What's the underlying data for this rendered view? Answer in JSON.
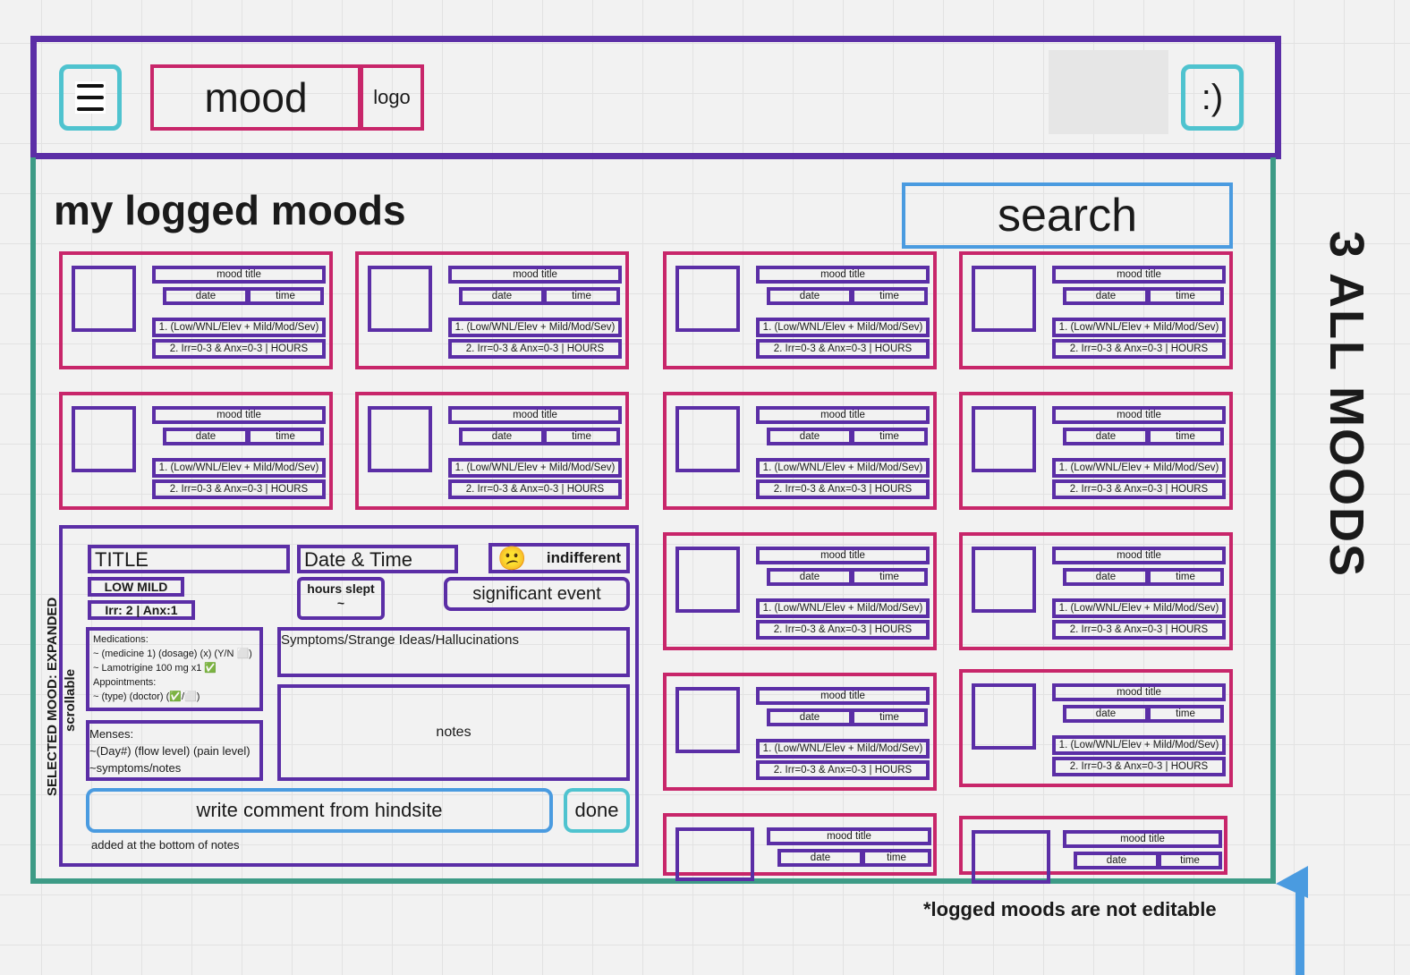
{
  "header": {
    "app_name": "mood",
    "logo_label": "logo",
    "profile_label": ":)",
    "menu_icon": "hamburger-menu-icon"
  },
  "main": {
    "title": "my logged moods",
    "search_label": "search",
    "side_label": "3 ALL MOODS",
    "footnote": "*logged moods are not editable"
  },
  "card_template": {
    "title": "mood title",
    "date": "date",
    "time": "time",
    "line1": "1. (Low/WNL/Elev + Mild/Mod/Sev)",
    "line2": "2. Irr=0-3 & Anx=0-3 | HOURS"
  },
  "selected": {
    "caption": "SELECTED MOOD: EXPANDED",
    "scroll_caption": "scrollable",
    "title": "TITLE",
    "datetime": "Date & Time",
    "mood_emoji": "😕",
    "mood_label": "indifferent",
    "level": "LOW MILD",
    "irr_anx": "Irr: 2 | Anx:1",
    "hours_slept": "hours slept",
    "hours_value": "~",
    "significant_event": "significant event",
    "medications": {
      "heading": "Medications:",
      "line1": "~ (medicine 1) (dosage) (x) (Y/N ⬜)",
      "line2": "~ Lamotrigine 100 mg x1 ✅",
      "appt_heading": "Appointments:",
      "line3": "~ (type) (doctor) (✅/⬜)"
    },
    "menses": {
      "heading": "Menses:",
      "line1": "~(Day#) (flow level) (pain level)",
      "line2": "~symptoms/notes"
    },
    "symptoms_label": "Symptoms/Strange Ideas/Hallucinations",
    "notes_label": "notes",
    "hindsight_button": "write comment from hindsite",
    "done_button": "done",
    "hindsight_note": "added at the bottom of notes"
  },
  "colors": {
    "purple": "#5b2ea6",
    "pink": "#c8266a",
    "teal": "#4fc3cf",
    "green": "#3d9b86",
    "blue": "#4a9be0"
  }
}
